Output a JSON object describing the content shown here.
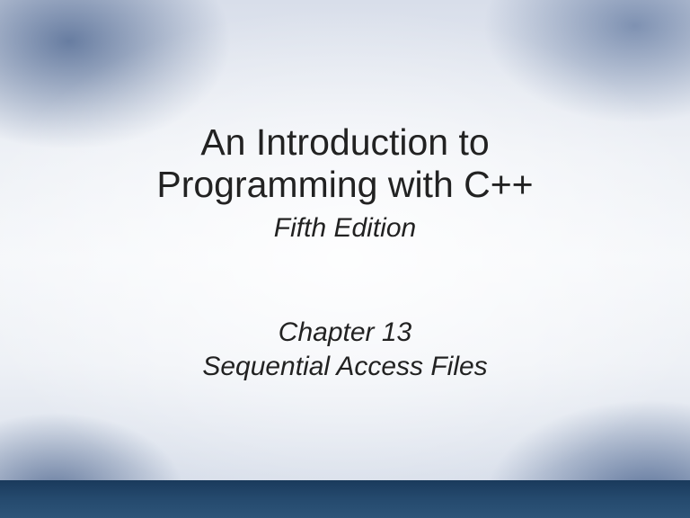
{
  "title": {
    "line1": "An Introduction to",
    "line2": "Programming with C++",
    "edition": "Fifth Edition"
  },
  "subtitle": {
    "chapter": "Chapter 13",
    "topic": "Sequential Access Files"
  }
}
